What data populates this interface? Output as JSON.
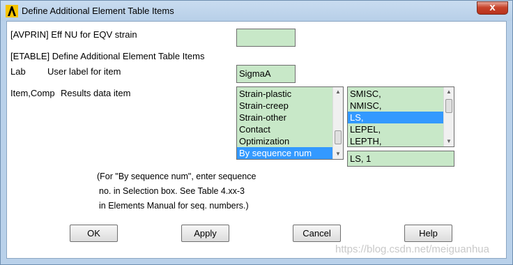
{
  "window": {
    "title": "Define Additional Element Table Items",
    "close_glyph": "x"
  },
  "avprin": {
    "label": "[AVPRIN]  Eff NU for EQV strain",
    "value": ""
  },
  "etable": {
    "heading": "[ETABLE]  Define Additional Element Table Items"
  },
  "lab": {
    "label_key": "Lab",
    "label_desc": "User label for item",
    "value": "SigmaA"
  },
  "item_comp": {
    "label_key": "Item,Comp",
    "label_desc": "Results data item",
    "left_list": [
      {
        "text": "Strain-plastic",
        "selected": false
      },
      {
        "text": "Strain-creep",
        "selected": false
      },
      {
        "text": "Strain-other",
        "selected": false
      },
      {
        "text": "Contact",
        "selected": false
      },
      {
        "text": "Optimization",
        "selected": false
      },
      {
        "text": "By sequence num",
        "selected": true
      }
    ],
    "right_list": [
      {
        "text": "SMISC,",
        "selected": false
      },
      {
        "text": "NMISC,",
        "selected": false
      },
      {
        "text": "LS,",
        "selected": true
      },
      {
        "text": "LEPEL,",
        "selected": false
      },
      {
        "text": "LEPTH,",
        "selected": false
      }
    ],
    "selection_value": "LS, 1"
  },
  "note": {
    "line1": "(For \"By sequence num\", enter sequence",
    "line2": "no. in Selection box.  See Table 4.xx-3",
    "line3": "in Elements Manual for seq. numbers.)"
  },
  "buttons": {
    "ok": "OK",
    "apply": "Apply",
    "cancel": "Cancel",
    "help": "Help"
  },
  "watermark": "https://blog.csdn.net/meiguanhua",
  "colors": {
    "field_bg": "#c8e8c8",
    "selection": "#3399ff",
    "frame": "#b9d1ea",
    "close": "#c7442b"
  }
}
